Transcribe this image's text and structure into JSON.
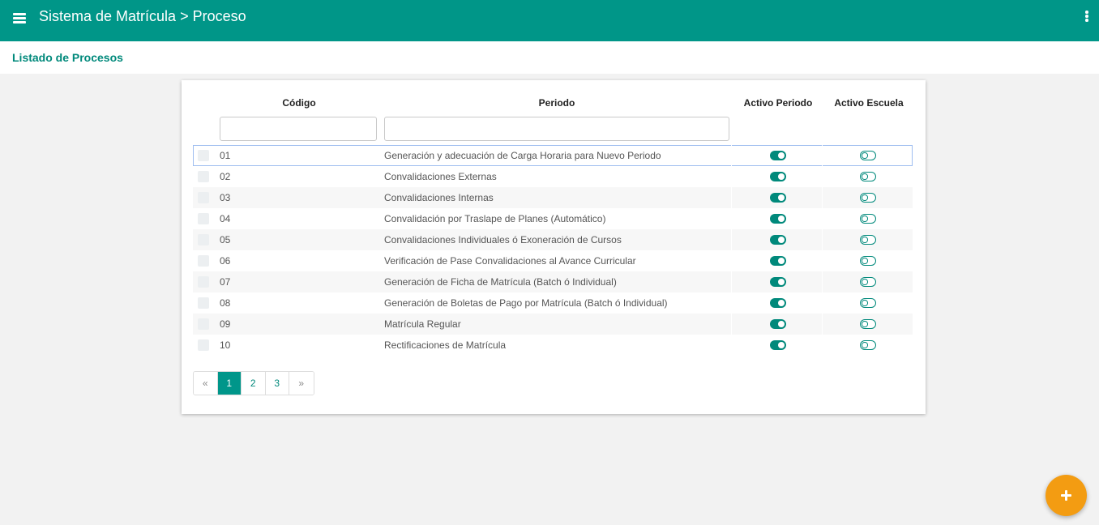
{
  "header": {
    "title": "Sistema de Matrícula > Proceso",
    "menu_icon": "hamburger-menu-icon",
    "more_icon": "vertical-dots-icon"
  },
  "page": {
    "title": "Listado de Procesos"
  },
  "table": {
    "columns": [
      "Código",
      "Periodo",
      "Activo Periodo",
      "Activo Escuela"
    ],
    "filters": {
      "codigo": "",
      "periodo": ""
    },
    "rows": [
      {
        "code": "01",
        "name": "Generación y adecuación de Carga Horaria para Nuevo Periodo",
        "activo_periodo": true,
        "activo_escuela": false
      },
      {
        "code": "02",
        "name": "Convalidaciones Externas",
        "activo_periodo": true,
        "activo_escuela": false
      },
      {
        "code": "03",
        "name": "Convalidaciones Internas",
        "activo_periodo": true,
        "activo_escuela": false
      },
      {
        "code": "04",
        "name": "Convalidación por Traslape de Planes (Automático)",
        "activo_periodo": true,
        "activo_escuela": false
      },
      {
        "code": "05",
        "name": "Convalidaciones Individuales ó Exoneración de Cursos",
        "activo_periodo": true,
        "activo_escuela": false
      },
      {
        "code": "06",
        "name": "Verificación de Pase Convalidaciones al Avance Curricular",
        "activo_periodo": true,
        "activo_escuela": false
      },
      {
        "code": "07",
        "name": "Generación de Ficha de Matrícula (Batch ó Individual)",
        "activo_periodo": true,
        "activo_escuela": false
      },
      {
        "code": "08",
        "name": "Generación de Boletas de Pago por Matrícula (Batch ó Individual)",
        "activo_periodo": true,
        "activo_escuela": false
      },
      {
        "code": "09",
        "name": "Matrícula Regular",
        "activo_periodo": true,
        "activo_escuela": false
      },
      {
        "code": "10",
        "name": "Rectificaciones de Matrícula",
        "activo_periodo": true,
        "activo_escuela": false
      }
    ]
  },
  "pagination": {
    "prev": "«",
    "pages": [
      "1",
      "2",
      "3"
    ],
    "next": "»",
    "current": "1"
  },
  "fab": {
    "icon": "plus-icon"
  },
  "colors": {
    "primary": "#009688",
    "accent": "#f39c12"
  }
}
